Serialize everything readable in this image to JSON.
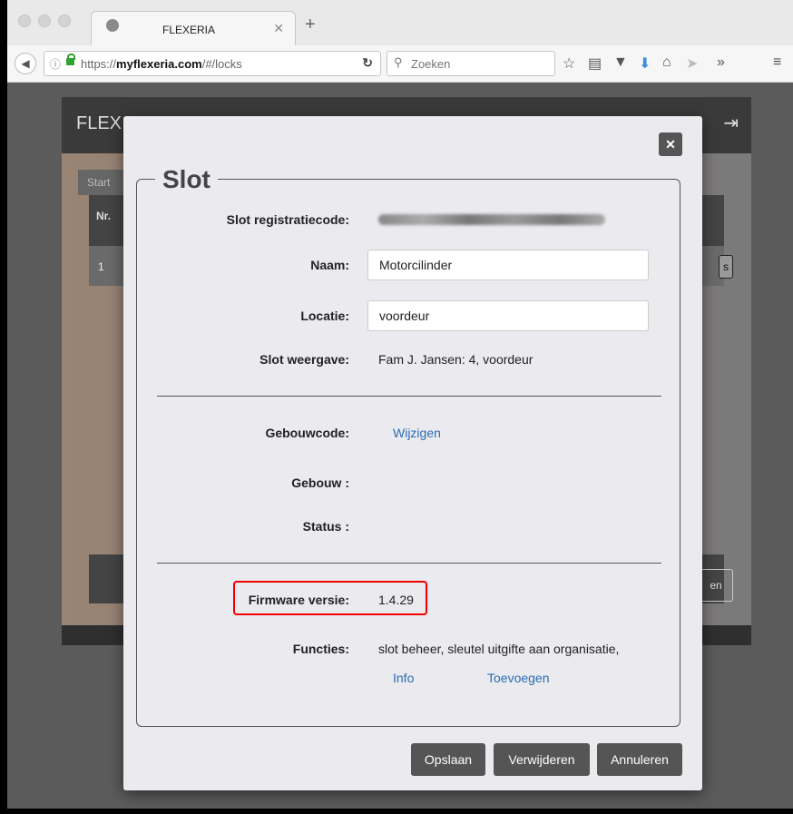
{
  "browser": {
    "tab_title": "FLEXERIA",
    "url_prefix": "https://",
    "url_host": "myflexeria.com",
    "url_path": "/#/locks",
    "search_placeholder": "Zoeken"
  },
  "background_app": {
    "logo": "FLEX",
    "tab_label": "Start",
    "table_header_nr": "Nr.",
    "row_nr": "1",
    "row_button_text": "s",
    "bottom_button_text": "en"
  },
  "modal": {
    "title": "Slot",
    "fields": {
      "registration_code_label": "Slot registratiecode:",
      "name_label": "Naam:",
      "name_value": "Motorcilinder",
      "location_label": "Locatie:",
      "location_value": "voordeur",
      "display_label": "Slot weergave:",
      "display_value": "Fam J. Jansen: 4, voordeur",
      "building_code_label": "Gebouwcode:",
      "building_code_link": "Wijzigen",
      "building_label": "Gebouw :",
      "status_label": "Status :",
      "firmware_label": "Firmware versie:",
      "firmware_value": "1.4.29",
      "functions_label": "Functies:",
      "functions_value": "slot beheer, sleutel uitgifte aan organisatie,",
      "info_link": "Info",
      "add_link": "Toevoegen"
    },
    "buttons": {
      "save": "Opslaan",
      "delete": "Verwijderen",
      "cancel": "Annuleren"
    }
  },
  "colors": {
    "link": "#2a6db5",
    "highlight": "#e00000",
    "button": "#555555"
  }
}
